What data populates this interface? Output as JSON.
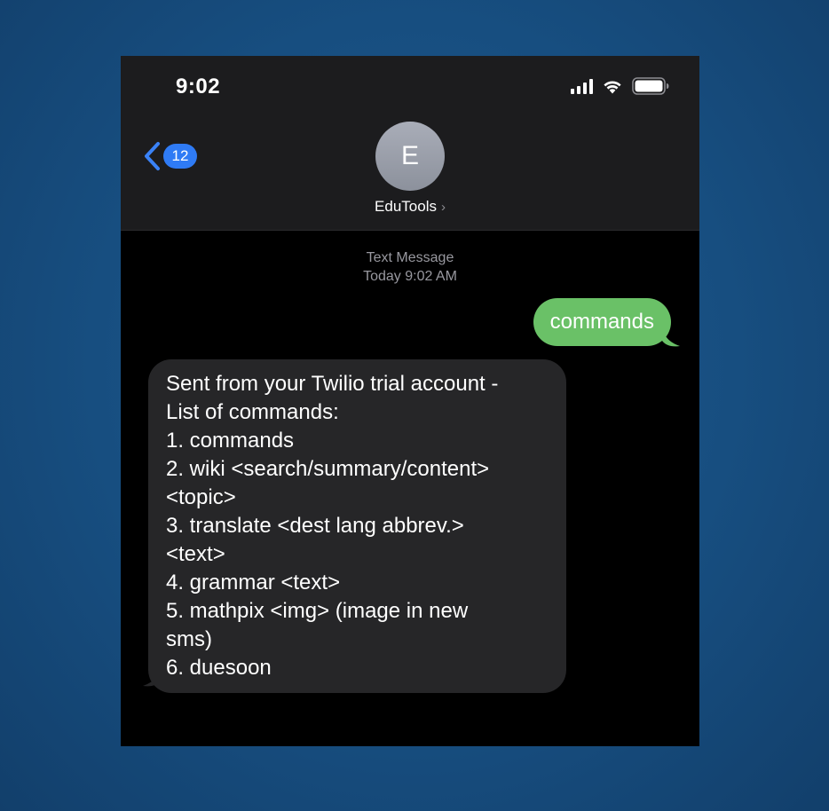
{
  "status_bar": {
    "time": "9:02",
    "icons": [
      "signal-icon",
      "wifi-icon",
      "battery-icon"
    ]
  },
  "header": {
    "back_badge_count": "12",
    "avatar_initial": "E",
    "contact_name": "EduTools",
    "chevron": "›"
  },
  "conversation": {
    "channel_label": "Text Message",
    "timestamp": "Today 9:02 AM",
    "messages": [
      {
        "direction": "sent",
        "text": "commands"
      },
      {
        "direction": "received",
        "lines": [
          "Sent from your Twilio trial account -",
          "List of commands:",
          "1. commands",
          "2. wiki <search/summary/content>",
          "<topic>",
          "3. translate <dest lang abbrev.>",
          "<text>",
          "4. grammar <text>",
          "5. mathpix <img> (image in new",
          "sms)",
          "6. duesoon"
        ]
      }
    ]
  },
  "colors": {
    "background": "#174e80",
    "screen": "#000000",
    "header": "#1c1c1e",
    "sent_bubble": "#6ac167",
    "received_bubble": "#262628",
    "badge": "#2f7bf5",
    "accent": "#3a82f7"
  }
}
